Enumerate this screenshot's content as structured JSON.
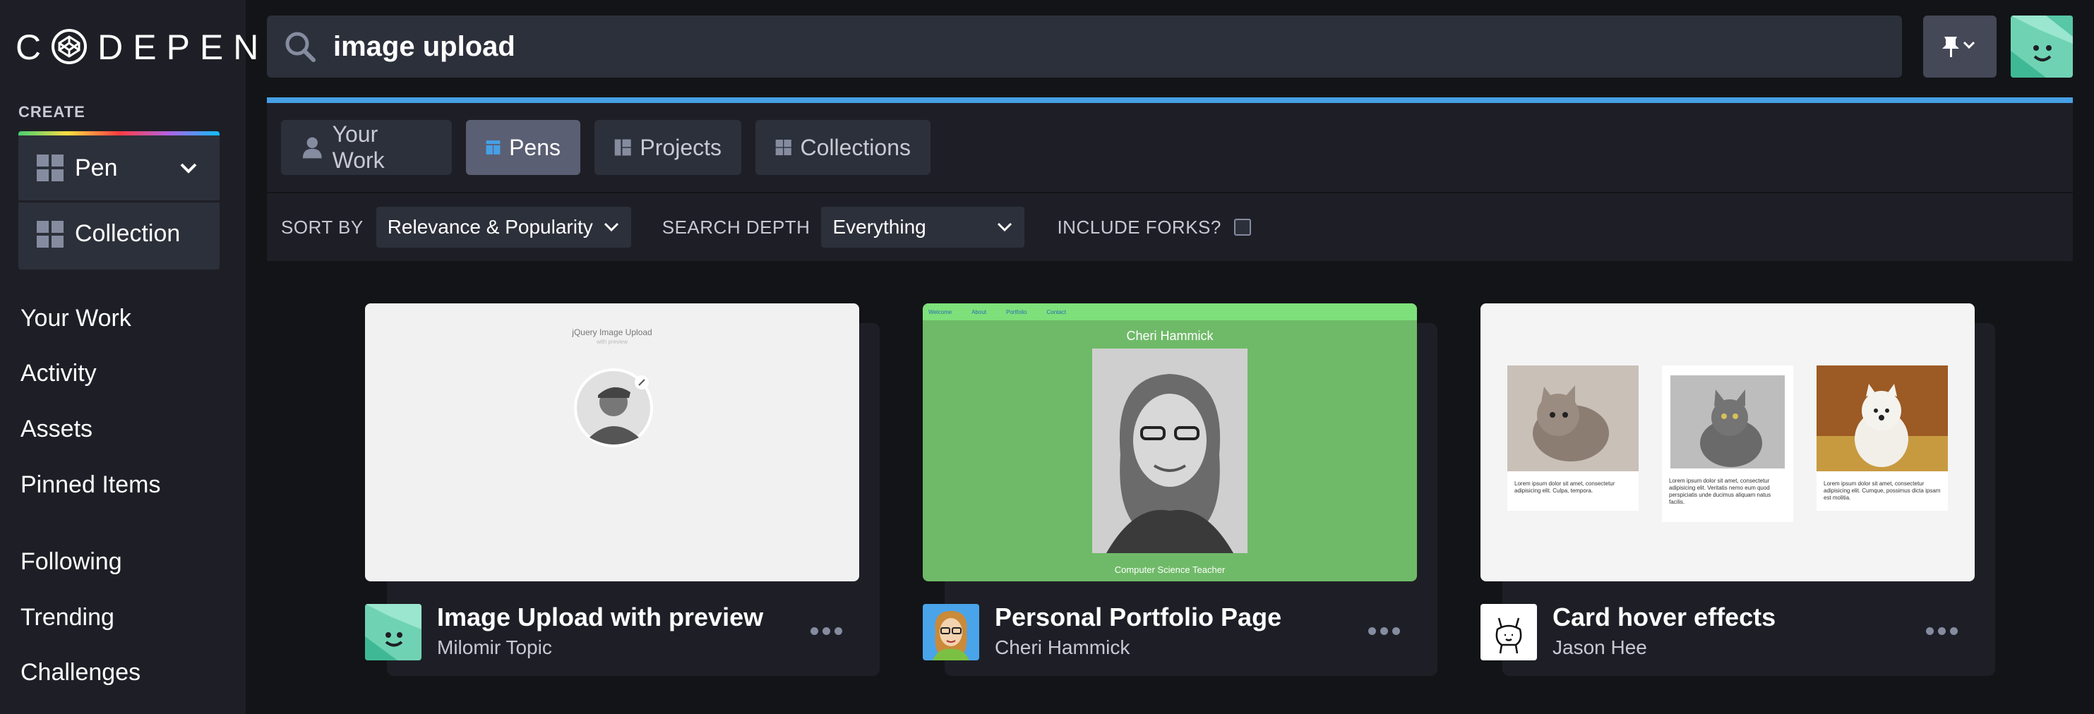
{
  "brand": {
    "logo_text_left": "C",
    "logo_text_right": "DEPEN"
  },
  "sidebar": {
    "create_label": "CREATE",
    "create_items": [
      {
        "label": "Pen",
        "icon": "pen-grid-icon"
      },
      {
        "label": "Collection",
        "icon": "collection-grid-icon"
      }
    ],
    "nav_items": [
      "Your Work",
      "Activity",
      "Assets",
      "Pinned Items",
      "Following",
      "Trending",
      "Challenges"
    ]
  },
  "search": {
    "query": "image upload",
    "icon": "search-icon"
  },
  "tabs": [
    {
      "label": "Your Work",
      "icon": "user-icon",
      "active": false
    },
    {
      "label": "Pens",
      "icon": "pens-grid-icon",
      "active": true
    },
    {
      "label": "Projects",
      "icon": "projects-icon",
      "active": false
    },
    {
      "label": "Collections",
      "icon": "collections-icon",
      "active": false
    }
  ],
  "filters": {
    "sort_by_label": "SORT BY",
    "sort_by_value": "Relevance & Popularity",
    "search_depth_label": "SEARCH DEPTH",
    "search_depth_value": "Everything",
    "include_forks_label": "INCLUDE FORKS?",
    "include_forks_checked": false
  },
  "cards": [
    {
      "title": "Image Upload with preview",
      "author": "Milomir Topic",
      "thumb": {
        "heading": "jQuery Image Upload",
        "subheading": "with preview"
      }
    },
    {
      "title": "Personal Portfolio Page",
      "author": "Cheri Hammick",
      "thumb": {
        "nav": [
          "Welcome",
          "About",
          "Portfolio",
          "Contact"
        ],
        "heading": "Cheri Hammick",
        "caption": "Computer Science Teacher"
      }
    },
    {
      "title": "Card hover effects",
      "author": "Jason Hee",
      "thumb": {
        "texts": [
          "Lorem ipsum dolor sit amet, consectetur adipisicing elit. Culpa, tempora.",
          "Lorem ipsum dolor sit amet, consectetur adipisicing elit. Veritatis nemo eum quod perspiciatis unde ducimus aliquam natus facilis.",
          "Lorem ipsum dolor sit amet, consectetur adipisicing elit. Cumque, possimus dicta ipsam est molitia."
        ]
      }
    }
  ],
  "colors": {
    "accent": "#47a0e6",
    "sidebar_bg": "#1e1f26",
    "page_bg": "#131417",
    "control_bg": "#2c303a"
  }
}
